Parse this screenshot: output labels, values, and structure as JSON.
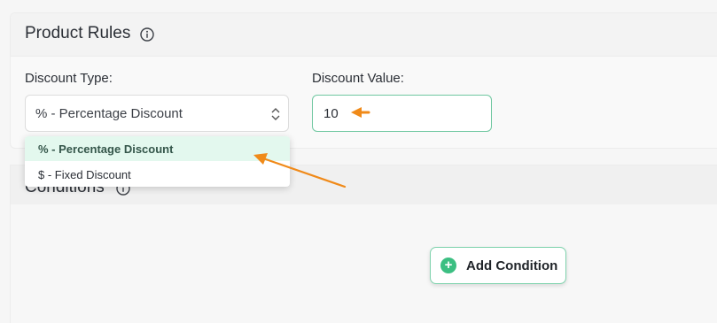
{
  "product_rules": {
    "title": "Product Rules",
    "discount_type_label": "Discount Type:",
    "discount_type_value": "% - Percentage Discount",
    "discount_value_label": "Discount Value:",
    "discount_value": "10"
  },
  "dropdown": {
    "options": [
      "% - Percentage Discount",
      "$ - Fixed Discount"
    ],
    "selected": "% - Percentage Discount"
  },
  "conditions": {
    "title": "Conditions",
    "add_button_label": "Add Condition"
  },
  "colors": {
    "accent": "#3cbf82",
    "annotation": "#f08a19"
  }
}
